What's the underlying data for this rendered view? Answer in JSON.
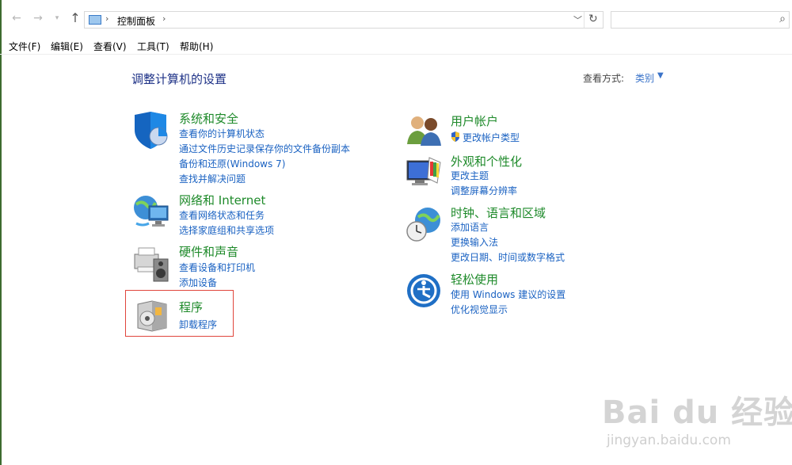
{
  "address_bar": {
    "breadcrumb": "控制面板",
    "separator": "›",
    "dropdown_icon": "chevron-down-icon",
    "refresh_icon": "refresh-icon"
  },
  "search": {
    "placeholder": "",
    "icon": "search-icon"
  },
  "menu": [
    "文件(F)",
    "编辑(E)",
    "查看(V)",
    "工具(T)",
    "帮助(H)"
  ],
  "main": {
    "title": "调整计算机的设置",
    "view_by_label": "查看方式:",
    "view_by_value": "类别"
  },
  "categories_left": [
    {
      "title": "系统和安全",
      "links": [
        "查看你的计算机状态",
        "通过文件历史记录保存你的文件备份副本",
        "备份和还原(Windows 7)",
        "查找并解决问题"
      ]
    },
    {
      "title": "网络和 Internet",
      "links": [
        "查看网络状态和任务",
        "选择家庭组和共享选项"
      ]
    },
    {
      "title": "硬件和声音",
      "links": [
        "查看设备和打印机",
        "添加设备"
      ]
    },
    {
      "title": "程序",
      "links": [
        "卸载程序"
      ]
    }
  ],
  "categories_right": [
    {
      "title": "用户帐户",
      "links": [
        "更改帐户类型"
      ]
    },
    {
      "title": "外观和个性化",
      "links": [
        "更改主题",
        "调整屏幕分辨率"
      ]
    },
    {
      "title": "时钟、语言和区域",
      "links": [
        "添加语言",
        "更换输入法",
        "更改日期、时间或数字格式"
      ]
    },
    {
      "title": "轻松使用",
      "links": [
        "使用 Windows 建议的设置",
        "优化视觉显示"
      ]
    }
  ],
  "watermark": {
    "main": "Bai du 经验",
    "sub": "jingyan.baidu.com"
  },
  "colors": {
    "title_blue": "#1e3287",
    "category_green": "#1e8a2a",
    "link_blue": "#1a62c2",
    "highlight_red": "#e0453c"
  }
}
